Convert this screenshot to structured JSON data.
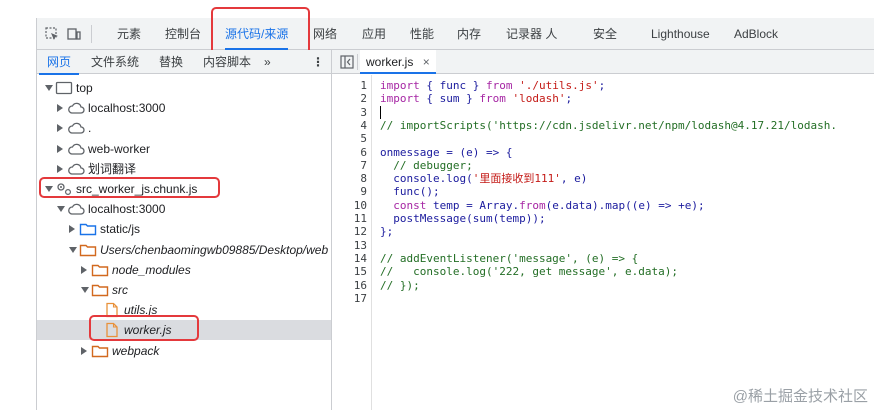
{
  "toolbar": {
    "tabs": [
      "元素",
      "控制台",
      "源代码/来源",
      "网络",
      "应用",
      "性能",
      "内存",
      "记录器 ⼈",
      "安全",
      "Lighthouse",
      "AdBlock"
    ],
    "active_tab": "源代码/来源"
  },
  "navigator": {
    "tabs": [
      "网页",
      "文件系统",
      "替换",
      "内容脚本",
      "»"
    ],
    "more": "⋮",
    "tree": [
      {
        "label": "top",
        "icon": "frame-icon",
        "twisty": "down"
      },
      {
        "label": "localhost:3000",
        "icon": "cloud-icon",
        "twisty": "right"
      },
      {
        "label": ".",
        "icon": "cloud-icon",
        "twisty": "right"
      },
      {
        "label": "web-worker",
        "icon": "cloud-icon",
        "twisty": "right"
      },
      {
        "label": "划词翻译",
        "icon": "cloud-icon",
        "twisty": "right"
      },
      {
        "label": "src_worker_js.chunk.js",
        "icon": "gear-icon",
        "twisty": "down"
      },
      {
        "label": "localhost:3000",
        "icon": "cloud-icon",
        "twisty": "down"
      },
      {
        "label": "static/js",
        "icon": "folder-icon",
        "twisty": "right"
      },
      {
        "label": "Users/chenbaomingwb09885/Desktop/web",
        "icon": "folder-icon",
        "twisty": "down",
        "italic": true
      },
      {
        "label": "node_modules",
        "icon": "folder-icon",
        "twisty": "right",
        "italic": true
      },
      {
        "label": "src",
        "icon": "folder-icon",
        "twisty": "down",
        "italic": true
      },
      {
        "label": "utils.js",
        "icon": "file-icon",
        "twisty": "",
        "italic": true
      },
      {
        "label": "worker.js",
        "icon": "file-icon",
        "twisty": "",
        "italic": true,
        "selected": true
      },
      {
        "label": "webpack",
        "icon": "folder-icon",
        "twisty": "right",
        "italic": true
      }
    ]
  },
  "editor": {
    "file_tab": "worker.js",
    "close_glyph": "×",
    "lines": [
      "import { func } from './utils.js';",
      "import { sum } from 'lodash';",
      "",
      "// importScripts('https://cdn.jsdelivr.net/npm/lodash@4.17.21/lodash.",
      "",
      "onmessage = (e) => {",
      "  // debugger;",
      "  console.log('里面接收到111', e)",
      "  func();",
      "  const temp = Array.from(e.data).map((e) => +e);",
      "  postMessage(sum(temp));",
      "};",
      "",
      "// addEventListener('message', (e) => {",
      "//   console.log('222, get message', e.data);",
      "// });",
      ""
    ]
  },
  "watermark": "@稀土掘金技术社区",
  "colors": {
    "accent": "#1a73e8",
    "highlight": "#e4393c",
    "folder": "#d2691e"
  }
}
